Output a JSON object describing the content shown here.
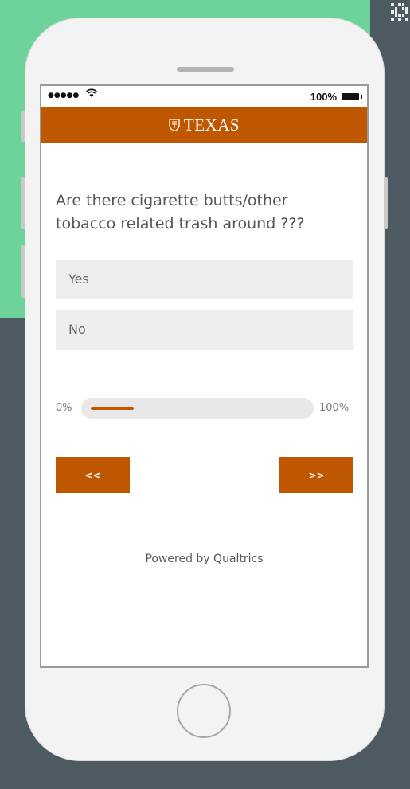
{
  "status_bar": {
    "signal": "●●●●●",
    "wifi_icon": "wifi-icon",
    "battery_text": "100%",
    "battery_icon": "battery-icon"
  },
  "header": {
    "brand": "TEXAS",
    "logo_icon": "shield-icon",
    "background_color": "#bf5700"
  },
  "question": {
    "text": "Are there cigarette butts/other tobacco related trash around ???"
  },
  "choices": [
    {
      "label": "Yes"
    },
    {
      "label": "No"
    }
  ],
  "progress": {
    "start_label": "0%",
    "end_label": "100%",
    "value_fraction": 0.2
  },
  "navigation": {
    "back_label": "<<",
    "next_label": ">>"
  },
  "footer": {
    "powered_by": "Powered by Qualtrics"
  },
  "colors": {
    "accent": "#bf5700",
    "page_background": "#4e5a62",
    "green_panel": "#6ed39a"
  }
}
